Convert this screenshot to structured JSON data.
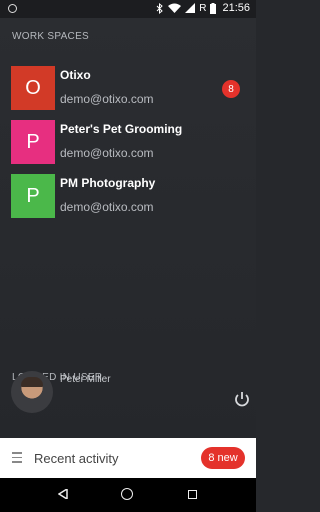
{
  "status_bar": {
    "time": "21:56",
    "battery_label": "R",
    "icons": [
      "bluetooth-icon",
      "wifi-icon",
      "signal-icon",
      "battery-icon"
    ]
  },
  "workspaces": {
    "section_label": "WORK SPACES",
    "items": [
      {
        "initial": "O",
        "name": "Otixo",
        "email": "demo@otixo.com",
        "color": "#d23a27",
        "badge": "8"
      },
      {
        "initial": "P",
        "name": "Peter's Pet Grooming",
        "email": "demo@otixo.com",
        "color": "#e72f80",
        "badge": null
      },
      {
        "initial": "P",
        "name": "PM Photography",
        "email": "demo@otixo.com",
        "color": "#4bb84a",
        "badge": null
      }
    ]
  },
  "logged_in": {
    "section_label": "LOGGED IN USER",
    "user_name": "Peter Miller"
  },
  "bottom_bar": {
    "title": "Recent activity",
    "new_badge": "8 new",
    "badge_color": "#e4322b"
  }
}
